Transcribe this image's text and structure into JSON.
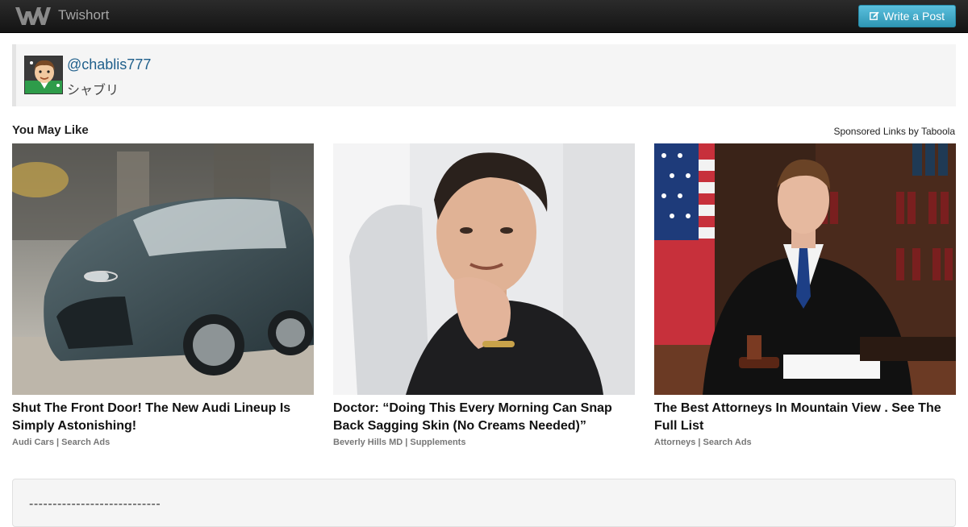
{
  "navbar": {
    "brand": "Twishort",
    "write_button_label": "Write a Post",
    "background": "#1b1b1b",
    "button_color": "#49afcd"
  },
  "profile": {
    "handle": "@chablis777",
    "display_name": "シャブリ"
  },
  "recommendations": {
    "heading": "You May Like",
    "sponsor": "Sponsored Links by Taboola",
    "cards": [
      {
        "title": "Shut The Front Door! The New Audi Lineup Is Simply Astonishing!",
        "source": "Audi Cars | Search Ads",
        "image": "car-photo"
      },
      {
        "title": "Doctor: “Doing This Every Morning Can Snap Back Sagging Skin (No Creams Needed)”",
        "source": "Beverly Hills MD | Supplements",
        "image": "doctor-photo"
      },
      {
        "title": "The Best Attorneys In Mountain View . See The Full List",
        "source": "Attorneys | Search Ads",
        "image": "attorney-photo"
      }
    ]
  },
  "post": {
    "text": "----------------------------"
  }
}
